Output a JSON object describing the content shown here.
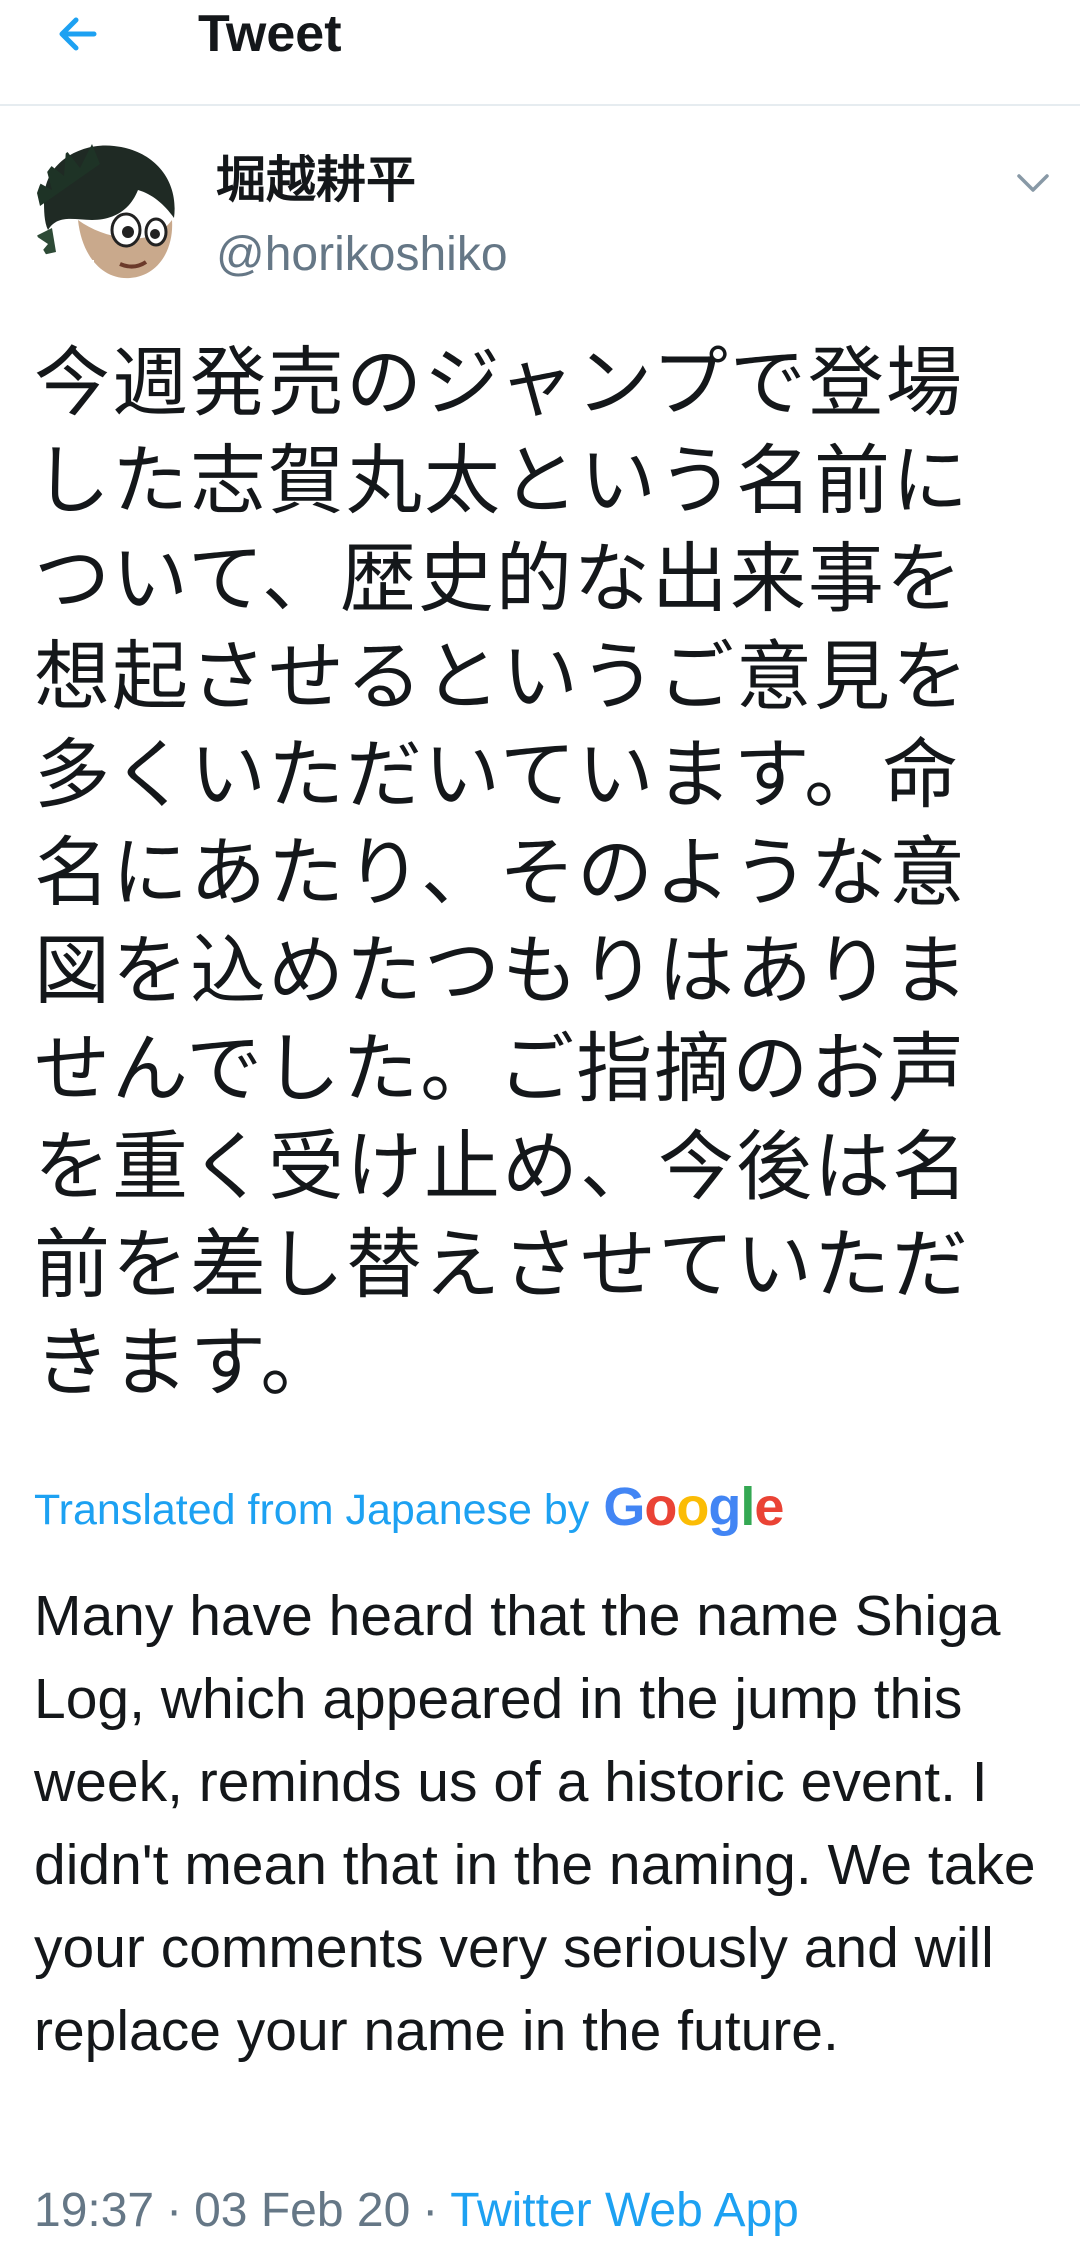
{
  "header": {
    "title": "Tweet",
    "back_icon": "arrow-left-icon",
    "accent_color": "#1da1f2"
  },
  "author": {
    "display_name": "堀越耕平",
    "handle": "@horikoshiko",
    "menu_icon": "chevron-down-icon"
  },
  "tweet": {
    "text": "今週発売のジャンプで登場した志賀丸太という名前について、歴史的な出来事を想起させるというご意見を多くいただいています。命名にあたり、そのような意図を込めたつもりはありませんでした。ご指摘のお声を重く受け止め、今後は名前を差し替えさせていただきます。"
  },
  "translation": {
    "label": "Translated from Japanese by",
    "provider_letters": [
      "G",
      "o",
      "o",
      "g",
      "l",
      "e"
    ],
    "text": "Many have heard that the name Shiga Log, which appeared in the jump this week, reminds us of a historic event. I didn't mean that in the naming. We take your comments very seriously and will replace your name in the future."
  },
  "meta": {
    "time": "19:37",
    "date": "03 Feb 20",
    "separator": "·",
    "source": "Twitter Web App"
  }
}
